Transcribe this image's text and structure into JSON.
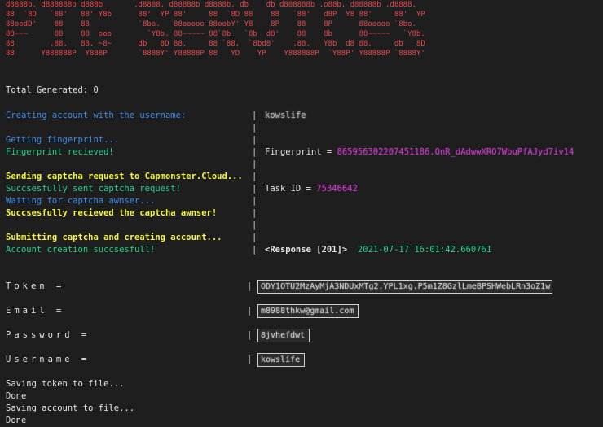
{
  "banner": {
    "ascii_art": "d8888b. d888888b d888b       .d8888. d88888b d8888b. db    db d888888b .o88b. d88888b .d8888.\n88  `8D   `88'   88' Y8b      88'  YP 88'     88  `8D 88    88   `88'   d8P  Y8 88'     88'  YP\n88oodD'    88    88           `8bo.   88ooooo 88oobY' Y8    8P    88    8P      88ooooo `8bo.\n88~~~      88    88  ooo        `Y8b. 88~~~~~ 88`8b   `8b  d8'    88    8b      88~~~~~   `Y8b.\n88        .88.   88. ~8~      db   8D 88.     88 `88.  `8bd8'    .88.   Y8b  d8 88.     db   8D\n88      Y888888P  Y888P       `8888Y' Y88888P 88   YD    YP    Y888888P  `Y88P' Y88888P `8888Y'"
  },
  "status": {
    "total_generated": "Total Generated: 0"
  },
  "log": {
    "creating": "Creating account with the username:",
    "username_shown": "kowslife",
    "getting_fp": "Getting fingerprint...",
    "fp_received": "Fingerprint recieved!",
    "fp_label": "Fingerprint = ",
    "fp_value": "865956302207451186.OnR_dAdwwXRO7WbuPfAJyd7iv14",
    "sending_captcha": "Sending captcha request to Capmonster.Cloud...",
    "sent_captcha": "Succsesfully sent captcha request!",
    "task_label": "Task ID = ",
    "task_value": "75346642",
    "waiting": "Waiting for captcha awnser...",
    "received_answer": "Succsesfully recieved the captcha awnser!",
    "submitting": "Submitting captcha and creating account...",
    "created": "Account creation succsesfull!",
    "response": "<Response [201]>",
    "timestamp": "2021-07-17 16:01:42.660761",
    "separator": "|"
  },
  "fields": {
    "token_label": "Token =",
    "token_value": "ODY1OTU2MzAyMjA3NDUxMTg2.YPL1xg.P5m1Z8GzlLmeBPSHWebLRn3oZ1w",
    "email_label": "Email =",
    "email_value": "m8988thkw@gmail.com",
    "password_label": "Password =",
    "password_value": "8jvhefdwt",
    "username_label": "Username =",
    "username_value": "kowslife"
  },
  "footer": {
    "saving_token": "Saving token to file...",
    "done1": "Done",
    "saving_account": "Saving account to file...",
    "done2": "Done"
  }
}
